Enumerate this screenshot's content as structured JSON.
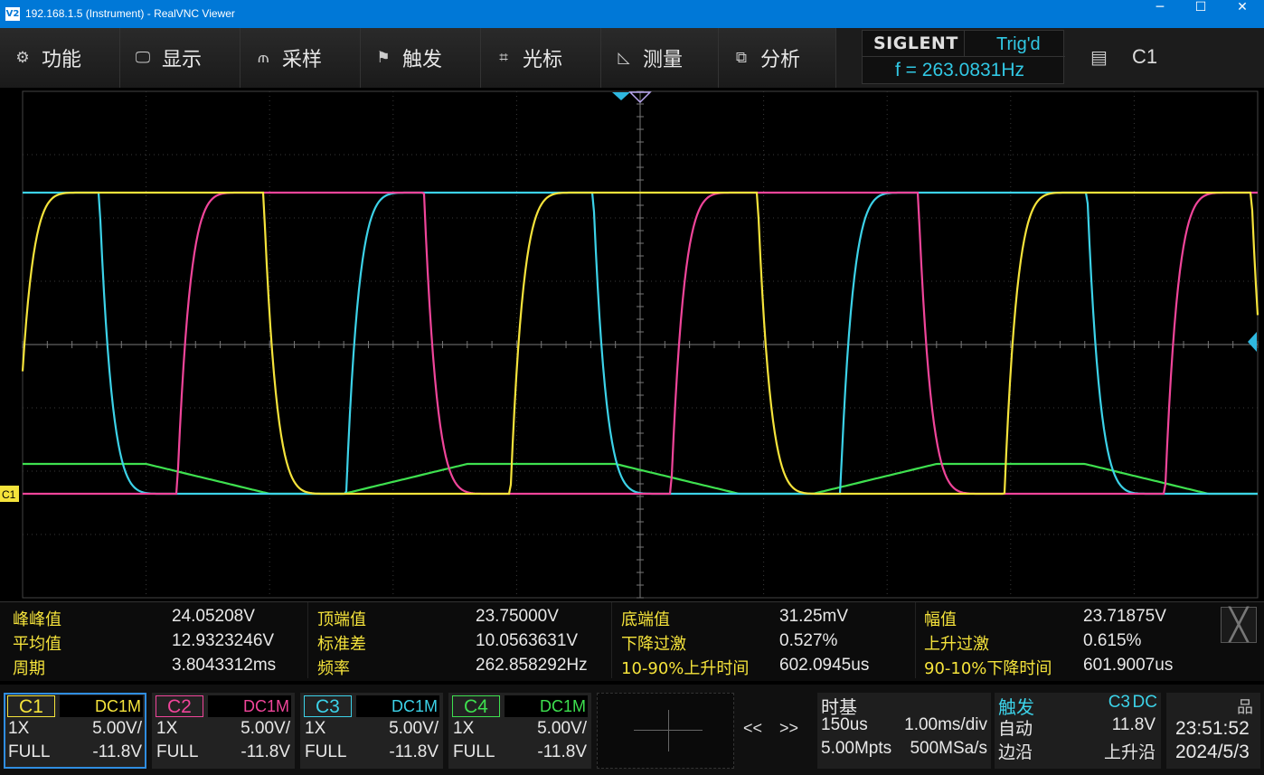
{
  "window": {
    "title": "192.168.1.5 (Instrument) - RealVNC Viewer",
    "app_icon": "vnc-icon",
    "minimize": "─",
    "maximize": "☐",
    "close": "✕"
  },
  "menu": [
    {
      "label": "功能",
      "icon": "gear-icon",
      "glyph": "⚙"
    },
    {
      "label": "显示",
      "icon": "monitor-icon",
      "glyph": "🖵"
    },
    {
      "label": "采样",
      "icon": "sample-icon",
      "glyph": "⫙"
    },
    {
      "label": "触发",
      "icon": "flag-icon",
      "glyph": "⚑"
    },
    {
      "label": "光标",
      "icon": "cursor-icon",
      "glyph": "⌗"
    },
    {
      "label": "测量",
      "icon": "ruler-icon",
      "glyph": "◺"
    },
    {
      "label": "分析",
      "icon": "analyze-icon",
      "glyph": "⧉"
    }
  ],
  "status": {
    "brand": "SIGLENT",
    "trigger_state": "Trig'd",
    "frequency": "f = 263.0831Hz",
    "channel_selected": "C1",
    "clipboard_icon": "clipboard-icon"
  },
  "scope": {
    "c1_marker": "C1",
    "colors": {
      "C1": "#f5e33b",
      "C2": "#f0459a",
      "C3": "#3cd2e8",
      "C4": "#3ee04f",
      "trigger": "#2fb8e0"
    }
  },
  "measurements": {
    "rows": [
      [
        {
          "label": "峰峰值",
          "value": "24.05208V"
        },
        {
          "label": "顶端值",
          "value": "23.75000V"
        },
        {
          "label": "底端值",
          "value": "31.25mV"
        },
        {
          "label": "幅值",
          "value": "23.71875V"
        }
      ],
      [
        {
          "label": "平均值",
          "value": "12.9323246V"
        },
        {
          "label": "标准差",
          "value": "10.0563631V"
        },
        {
          "label": "下降过激",
          "value": "0.527%"
        },
        {
          "label": "上升过激",
          "value": "0.615%"
        }
      ],
      [
        {
          "label": "周期",
          "value": "3.8043312ms"
        },
        {
          "label": "频率",
          "value": "262.858292Hz"
        },
        {
          "label": "10-90%上升时间",
          "value": "602.0945us"
        },
        {
          "label": "90-10%下降时间",
          "value": "601.9007us"
        }
      ]
    ],
    "close": "╳"
  },
  "channels": [
    {
      "name": "C1",
      "coupling": "DC1M",
      "probe": "1X",
      "scale": "5.00V/",
      "bw": "FULL",
      "offset": "-11.8V",
      "color": "#f5e33b",
      "active": true
    },
    {
      "name": "C2",
      "coupling": "DC1M",
      "probe": "1X",
      "scale": "5.00V/",
      "bw": "FULL",
      "offset": "-11.8V",
      "color": "#f0459a",
      "active": false
    },
    {
      "name": "C3",
      "coupling": "DC1M",
      "probe": "1X",
      "scale": "5.00V/",
      "bw": "FULL",
      "offset": "-11.8V",
      "color": "#3cd2e8",
      "active": false
    },
    {
      "name": "C4",
      "coupling": "DC1M",
      "probe": "1X",
      "scale": "5.00V/",
      "bw": "FULL",
      "offset": "-11.8V",
      "color": "#3ee04f",
      "active": false
    }
  ],
  "nav": {
    "prev": "<<",
    "next": ">>"
  },
  "timebase": {
    "title": "时基",
    "delay": "150us",
    "scale": "1.00ms/div",
    "depth": "5.00Mpts",
    "rate": "500MSa/s"
  },
  "trigger": {
    "title": "触发",
    "source": "C3",
    "coupling": "DC",
    "mode": "自动",
    "level": "11.8V",
    "type": "边沿",
    "slope": "上升沿"
  },
  "clock": {
    "time": "23:51:52",
    "date": "2024/5/3",
    "icon": "network-icon"
  }
}
